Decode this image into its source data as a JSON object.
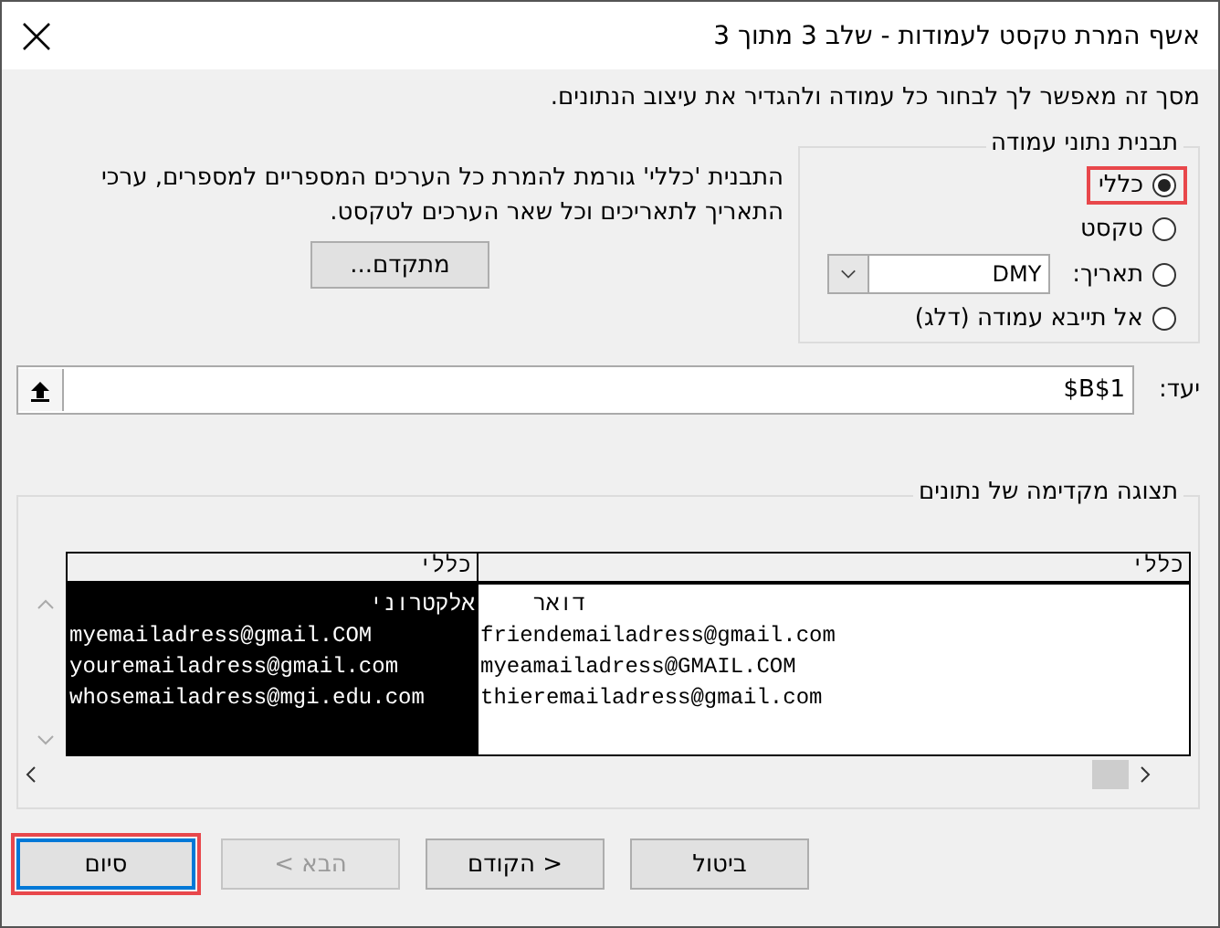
{
  "window": {
    "title": "אשף המרת טקסט לעמודות - שלב 3 מתוך 3"
  },
  "description": "מסך זה מאפשר לך לבחור כל עמודה ולהגדיר את עיצוב הנתונים.",
  "column_format": {
    "title": "תבנית נתוני עמודה",
    "options": [
      {
        "kind": "plain",
        "label": "כללי",
        "selected": true,
        "highlighted": true
      },
      {
        "kind": "plain",
        "label": "טקסט",
        "selected": false,
        "highlighted": false
      },
      {
        "kind": "date",
        "label": "תאריך:",
        "value": "DMY",
        "selected": false,
        "highlighted": false
      },
      {
        "kind": "plain",
        "label": "אל תייבא עמודה (דלג)",
        "selected": false,
        "highlighted": false
      }
    ]
  },
  "explanation": "התבנית 'כללי' גורמת להמרת כל הערכים המספריים למספרים, ערכי התאריך לתאריכים וכל שאר הערכים לטקסט.",
  "advanced_button": "מתקדם...",
  "destination": {
    "label": "יעד:",
    "value": "$B$1"
  },
  "preview": {
    "title": "תצוגה מקדימה של נתונים",
    "columns": [
      {
        "header": "כללי",
        "selected": false,
        "lines": [
          "    דואר",
          "friendemailadress@gmail.com",
          "myeamailadress@GMAIL.COM",
          "thieremailadress@gmail.com"
        ]
      },
      {
        "header": "כללי",
        "selected": true,
        "lines": [
          "אלקטרוני",
          "myemailadress@gmail.COM",
          "youremailadress@gmail.com",
          "whosemailadress@mgi.edu.com"
        ]
      }
    ]
  },
  "buttons": [
    {
      "label": "ביטול",
      "disabled": false,
      "highlighted": false
    },
    {
      "label": "< הקודם",
      "disabled": false,
      "highlighted": false
    },
    {
      "label": "הבא >",
      "disabled": true,
      "highlighted": false
    },
    {
      "label": "סיום",
      "disabled": false,
      "highlighted": true
    }
  ]
}
